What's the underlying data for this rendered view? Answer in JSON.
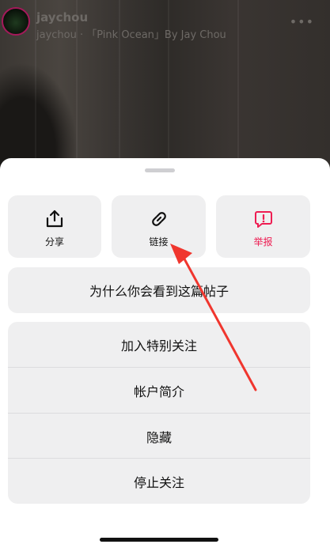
{
  "post": {
    "username": "jaychou",
    "subtitle": "jaychou · 「Pink Ocean」By Jay Chou"
  },
  "sheet": {
    "actions": [
      {
        "label": "分享",
        "icon": "share-icon"
      },
      {
        "label": "链接",
        "icon": "link-icon"
      },
      {
        "label": "举报",
        "icon": "report-icon"
      }
    ],
    "why_label": "为什么你会看到这篇帖子",
    "menu": [
      {
        "label": "加入特别关注"
      },
      {
        "label": "帐户简介"
      },
      {
        "label": "隐藏"
      },
      {
        "label": "停止关注"
      }
    ]
  },
  "colors": {
    "accent_red": "#ee1d52",
    "tile_bg": "#efeff0",
    "arrow": "#f0362e"
  }
}
